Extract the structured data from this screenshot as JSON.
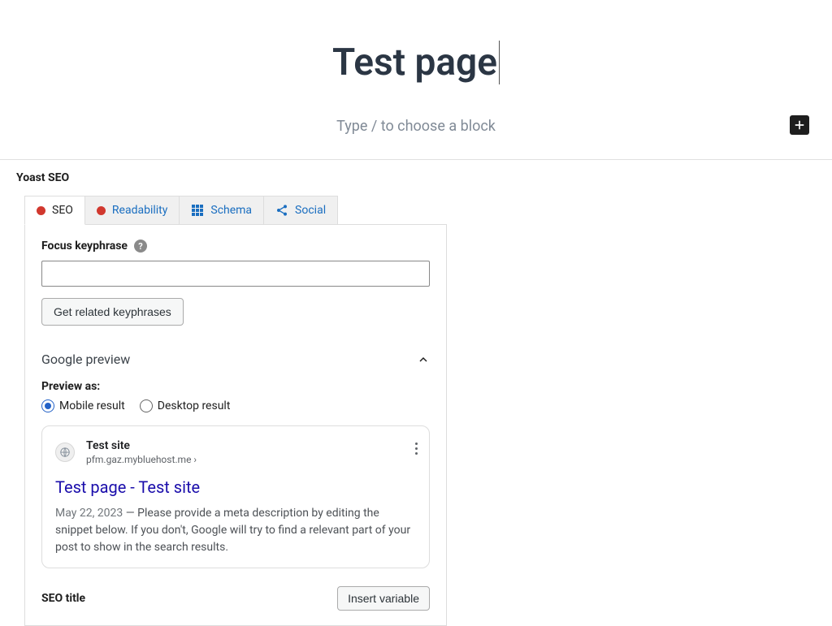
{
  "editor": {
    "page_title": "Test page",
    "block_placeholder": "Type / to choose a block"
  },
  "yoast": {
    "panel_title": "Yoast SEO",
    "tabs": {
      "seo": "SEO",
      "readability": "Readability",
      "schema": "Schema",
      "social": "Social"
    },
    "focus_keyphrase_label": "Focus keyphrase",
    "focus_keyphrase_value": "",
    "related_button": "Get related keyphrases",
    "google_preview_header": "Google preview",
    "preview_as_label": "Preview as:",
    "preview_options": {
      "mobile": "Mobile result",
      "desktop": "Desktop result"
    },
    "snippet": {
      "site_name": "Test site",
      "site_url": "pfm.gaz.mybluehost.me ›",
      "title": "Test page - Test site",
      "date": "May 22, 2023",
      "description": "Please provide a meta description by editing the snippet below. If you don't, Google will try to find a relevant part of your post to show in the search results."
    },
    "seo_title_label": "SEO title",
    "insert_variable_button": "Insert variable"
  },
  "colors": {
    "tab_link": "#1a6ec0",
    "danger_dot": "#d1382e",
    "serp_title": "#1a0dab"
  }
}
